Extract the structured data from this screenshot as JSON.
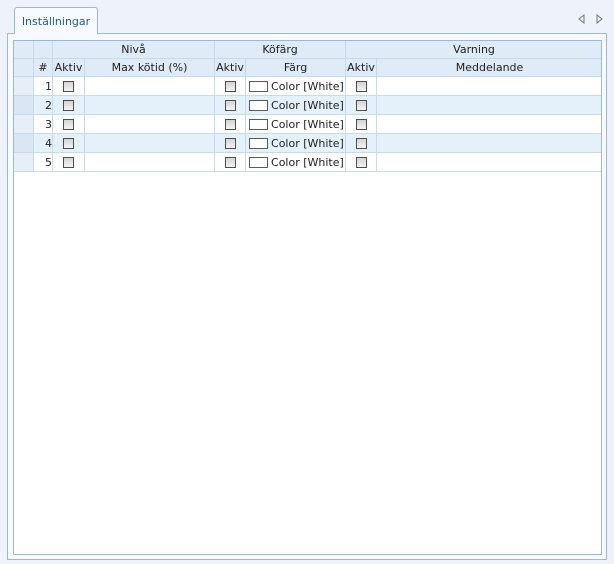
{
  "tabs": [
    {
      "label": "Inställningar",
      "active": true
    }
  ],
  "tab_nav": {
    "prev_icon": "triangle-left-icon",
    "next_icon": "triangle-right-icon"
  },
  "grid": {
    "group_headers": {
      "level": "Nivå",
      "queue_color": "Köfärg",
      "warning": "Varning"
    },
    "columns": {
      "row_number": "#",
      "level_active": "Aktiv",
      "max_queue_time": "Max kötid (%)",
      "color_active": "Aktiv",
      "color": "Färg",
      "warning_active": "Aktiv",
      "message": "Meddelande"
    },
    "rows": [
      {
        "num": "1",
        "level_active": false,
        "max_queue_time": "",
        "color_active": false,
        "color": "Color [White]",
        "swatch": "#ffffff",
        "warning_active": false,
        "message": ""
      },
      {
        "num": "2",
        "level_active": false,
        "max_queue_time": "",
        "color_active": false,
        "color": "Color [White]",
        "swatch": "#ffffff",
        "warning_active": false,
        "message": ""
      },
      {
        "num": "3",
        "level_active": false,
        "max_queue_time": "",
        "color_active": false,
        "color": "Color [White]",
        "swatch": "#ffffff",
        "warning_active": false,
        "message": ""
      },
      {
        "num": "4",
        "level_active": false,
        "max_queue_time": "",
        "color_active": false,
        "color": "Color [White]",
        "swatch": "#ffffff",
        "warning_active": false,
        "message": ""
      },
      {
        "num": "5",
        "level_active": false,
        "max_queue_time": "",
        "color_active": false,
        "color": "Color [White]",
        "swatch": "#ffffff",
        "warning_active": false,
        "message": ""
      }
    ]
  },
  "colors": {
    "accent": "#1d5c9e",
    "header_bg": "#e0ebf8",
    "alt_row_bg": "#e4f1fb",
    "border": "#9fb6d6"
  }
}
